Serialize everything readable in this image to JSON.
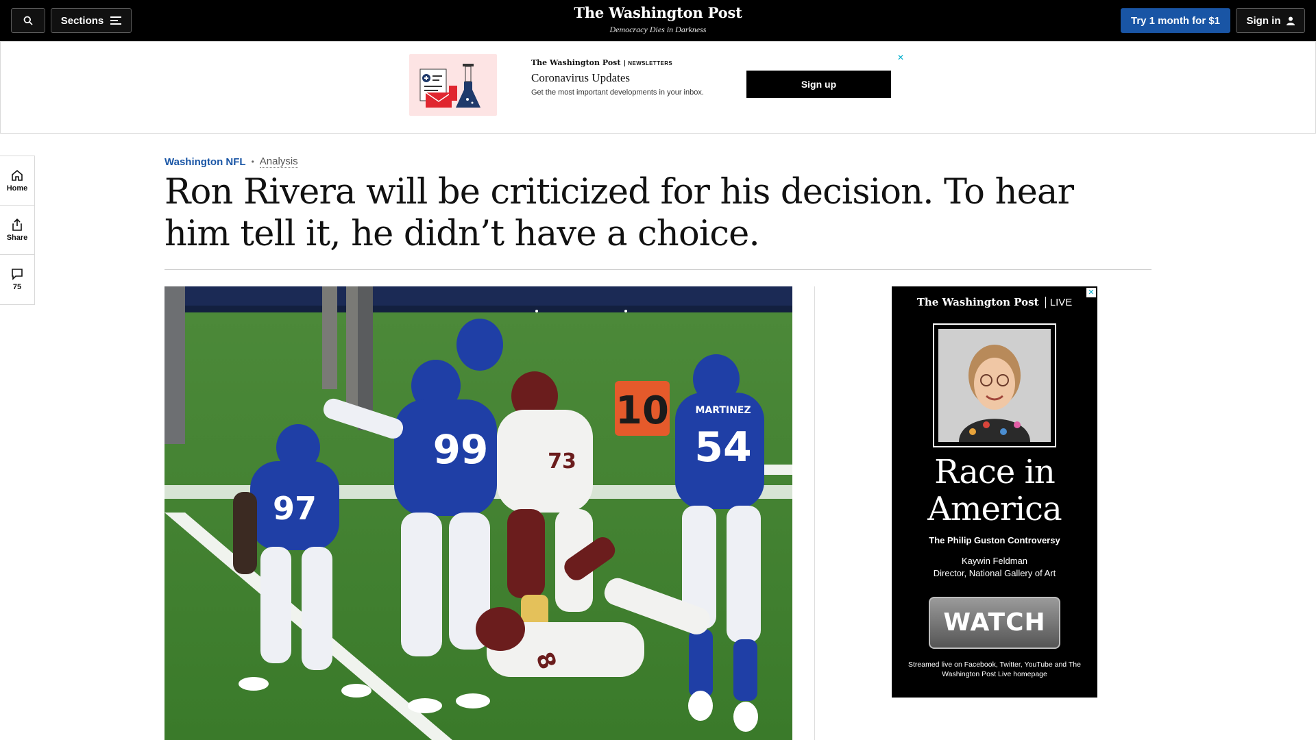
{
  "header": {
    "sections_label": "Sections",
    "logo": "The Washington Post",
    "tagline": "Democracy Dies in Darkness",
    "subscribe_label": "Try 1 month for $1",
    "signin_label": "Sign in"
  },
  "newsletter_ad": {
    "brand": "The Washington Post",
    "brand_tag": "NEWSLETTERS",
    "title": "Coronavirus Updates",
    "subtitle": "Get the most important developments in your inbox.",
    "cta": "Sign up",
    "close": "✕"
  },
  "rail": {
    "home_label": "Home",
    "share_label": "Share",
    "comments_count": "75"
  },
  "article": {
    "section": "Washington NFL",
    "separator": "•",
    "label": "Analysis",
    "headline": "Ron Rivera will be criticized for his decision. To hear him tell it, he didn’t have a choice."
  },
  "photo": {
    "marker_number": "10",
    "jersey_numbers": [
      "97",
      "99",
      "73",
      "54",
      "8"
    ],
    "name_on_jersey": "MARTINEZ"
  },
  "live_ad": {
    "brand": "The Washington Post",
    "brand_tag": "LIVE",
    "title": "Race in America",
    "subtitle": "The Philip Guston Controversy",
    "speaker_name": "Kaywin Feldman",
    "speaker_title": "Director, National Gallery of Art",
    "cta": "WATCH",
    "footer": "Streamed live on Facebook, Twitter, YouTube and The Washington Post Live homepage",
    "close": "✕"
  },
  "colors": {
    "accent_blue": "#1955a5",
    "topbar_bg": "#000000",
    "field_green": "#3d7a2b",
    "giants_blue": "#1f3fa6",
    "washington_burgundy": "#6b1d1d"
  }
}
